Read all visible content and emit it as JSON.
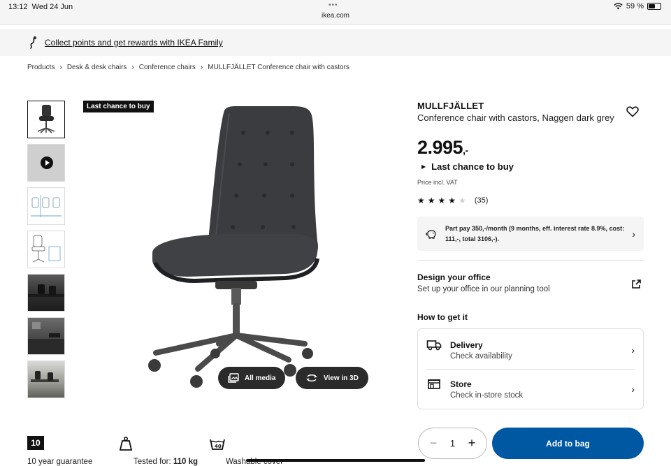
{
  "status_bar": {
    "time": "13:12",
    "date": "Wed 24 Jun",
    "url": "ikea.com",
    "battery_percent": "59 %",
    "battery_level": 0.59
  },
  "banner": {
    "icon": "family-tag-icon",
    "text": "Collect points and get rewards with IKEA Family"
  },
  "breadcrumb": [
    "Products",
    "Desk & desk chairs",
    "Conference chairs",
    "MULLFJÄLLET Conference chair with castors"
  ],
  "gallery": {
    "tag": "Last chance to buy",
    "thumbnails": [
      {
        "type": "product",
        "selected": true
      },
      {
        "type": "video"
      },
      {
        "type": "dimensions"
      },
      {
        "type": "dimensions"
      },
      {
        "type": "room"
      },
      {
        "type": "room"
      },
      {
        "type": "room"
      }
    ],
    "all_media_label": "All media",
    "view_3d_label": "View in 3D"
  },
  "product": {
    "name": "MULLFJÄLLET",
    "description": "Conference chair with castors, Naggen dark grey",
    "price": "2.995",
    "price_suffix": ",-",
    "status": "Last chance to buy",
    "vat_note": "Price incl. VAT",
    "rating": 4,
    "rating_max": 5,
    "review_count": "(35)"
  },
  "part_pay": {
    "text": "Part pay 350,-/month (9 months, eff. interest rate 8.9%, cost: 111,-, total 3106,-)."
  },
  "design": {
    "title": "Design your office",
    "subtitle": "Set up your office in our planning tool"
  },
  "get_it": {
    "heading": "How to get it",
    "options": [
      {
        "icon": "truck-icon",
        "title": "Delivery",
        "subtitle": "Check availability"
      },
      {
        "icon": "store-icon",
        "title": "Store",
        "subtitle": "Check in-store stock"
      }
    ]
  },
  "cart": {
    "quantity": "1",
    "add_label": "Add to bag"
  },
  "features": [
    {
      "icon": "guarantee-10-icon",
      "badge": "10",
      "label": "10 year guarantee"
    },
    {
      "icon": "weight-icon",
      "label_prefix": "Tested for: ",
      "label_value": "110 kg"
    },
    {
      "icon": "washable-icon",
      "label": "Washable cover"
    }
  ],
  "colors": {
    "primary_button": "#0058a3",
    "tag_bg": "#111111",
    "banner_bg": "#f5f5f5"
  }
}
